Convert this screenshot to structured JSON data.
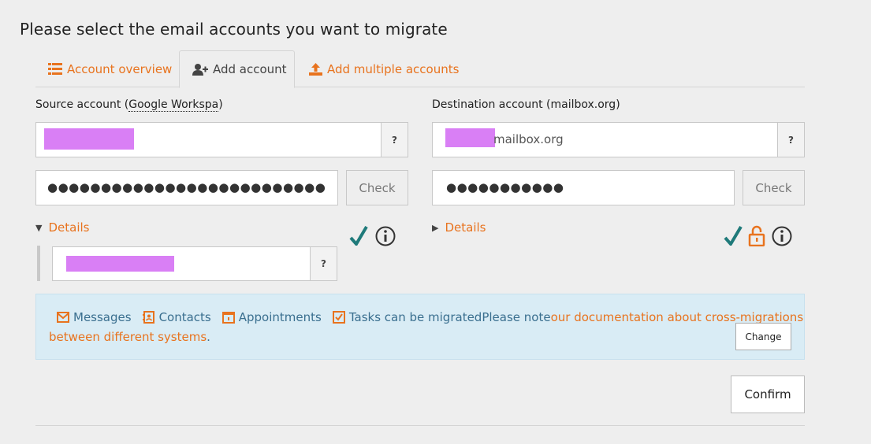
{
  "page": {
    "title": "Please select the email accounts you want to migrate"
  },
  "tabs": {
    "overview": "Account overview",
    "add": "Add account",
    "multiple": "Add multiple accounts"
  },
  "source": {
    "label_prefix": "Source account (",
    "label_abbr": "Google Workspa",
    "label_suffix": ")",
    "help": "?",
    "password_dots": "●●●●●●●●●●●●●●●●●●●●●●●●●●●●●●●●●●●",
    "check": "Check",
    "details": "Details",
    "extra_help": "?"
  },
  "destination": {
    "label": "Destination account (mailbox.org)",
    "email_suffix": "mailbox.org",
    "help": "?",
    "password_dots": "●●●●●●●●●●●",
    "check": "Check",
    "details": "Details"
  },
  "info": {
    "messages": "Messages",
    "contacts": "Contacts",
    "appointments": "Appointments",
    "tasks": "Tasks can be migrated",
    "note": "Please note ",
    "link1": "our documentation about cross-migrations",
    "link2": "between different systems",
    "period": ".",
    "change": "Change"
  },
  "actions": {
    "confirm": "Confirm"
  },
  "colors": {
    "accent": "#e8731e",
    "check": "#1f7a7a",
    "info_bg": "#d9ecf5",
    "redaction": "#d97ff5"
  }
}
